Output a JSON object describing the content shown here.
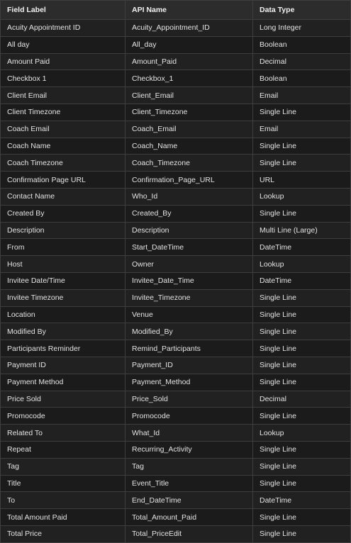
{
  "table": {
    "headers": [
      "Field Label",
      "API Name",
      "Data Type"
    ],
    "rows": [
      [
        "Acuity Appointment ID",
        "Acuity_Appointment_ID",
        "Long Integer"
      ],
      [
        "All day",
        "All_day",
        "Boolean"
      ],
      [
        "Amount Paid",
        "Amount_Paid",
        "Decimal"
      ],
      [
        "Checkbox 1",
        "Checkbox_1",
        "Boolean"
      ],
      [
        "Client Email",
        "Client_Email",
        "Email"
      ],
      [
        "Client Timezone",
        "Client_Timezone",
        "Single Line"
      ],
      [
        "Coach Email",
        "Coach_Email",
        "Email"
      ],
      [
        "Coach Name",
        "Coach_Name",
        "Single Line"
      ],
      [
        "Coach Timezone",
        "Coach_Timezone",
        "Single Line"
      ],
      [
        "Confirmation Page URL",
        "Confirmation_Page_URL",
        "URL"
      ],
      [
        "Contact Name",
        "Who_Id",
        "Lookup"
      ],
      [
        "Created By",
        "Created_By",
        "Single Line"
      ],
      [
        "Description",
        "Description",
        "Multi Line (Large)"
      ],
      [
        "From",
        "Start_DateTime",
        "DateTime"
      ],
      [
        "Host",
        "Owner",
        "Lookup"
      ],
      [
        "Invitee Date/Time",
        "Invitee_Date_Time",
        "DateTime"
      ],
      [
        "Invitee Timezone",
        "Invitee_Timezone",
        "Single Line"
      ],
      [
        "Location",
        "Venue",
        "Single Line"
      ],
      [
        "Modified By",
        "Modified_By",
        "Single Line"
      ],
      [
        "Participants Reminder",
        "Remind_Participants",
        "Single Line"
      ],
      [
        "Payment ID",
        "Payment_ID",
        "Single Line"
      ],
      [
        "Payment Method",
        "Payment_Method",
        "Single Line"
      ],
      [
        "Price Sold",
        "Price_Sold",
        "Decimal"
      ],
      [
        "Promocode",
        "Promocode",
        "Single Line"
      ],
      [
        "Related To",
        "What_Id",
        "Lookup"
      ],
      [
        "Repeat",
        "Recurring_Activity",
        "Single Line"
      ],
      [
        "Tag",
        "Tag",
        "Single Line"
      ],
      [
        "Title",
        "Event_Title",
        "Single Line"
      ],
      [
        "To",
        "End_DateTime",
        "DateTime"
      ],
      [
        "Total Amount Paid",
        "Total_Amount_Paid",
        "Single Line"
      ],
      [
        "Total Price",
        "Total_PriceEdit",
        "Single Line"
      ]
    ]
  }
}
